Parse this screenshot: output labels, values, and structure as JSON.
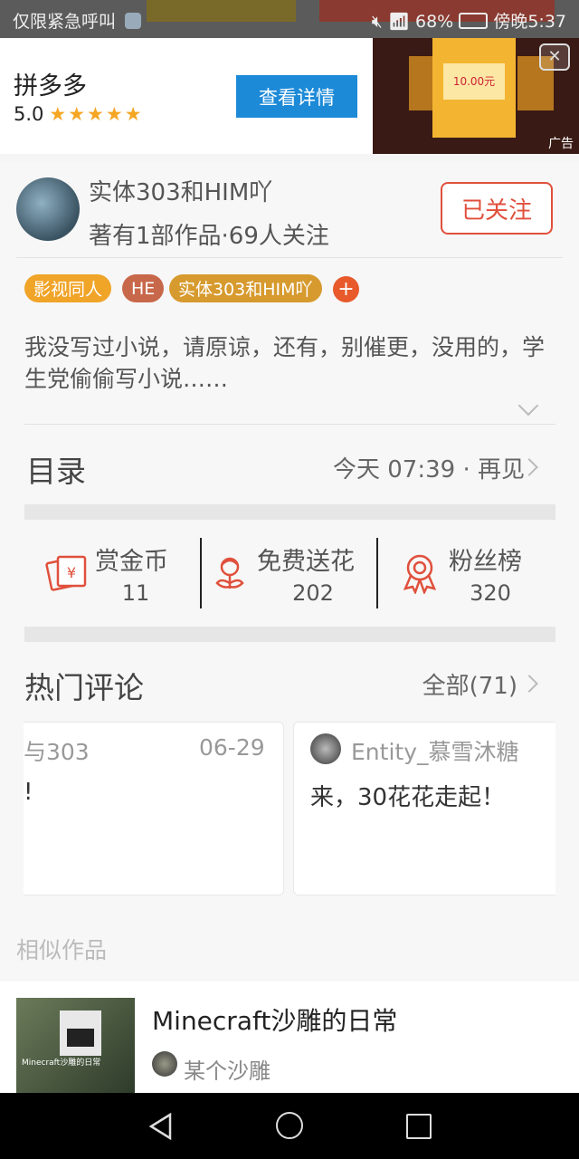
{
  "status_bar": {
    "left_text": "仅限紧急呼叫",
    "battery": "68%",
    "time": "傍晚5:37"
  },
  "ad": {
    "app_name": "拼多多",
    "rating": "5.0",
    "stars": "★★★★★",
    "button_label": "查看详情",
    "thumb_amount": "10.00元",
    "ad_tag": "广告"
  },
  "author": {
    "name": "实体303和HIM吖",
    "stats": "著有1部作品·69人关注",
    "follow_label": "已关注"
  },
  "tags": [
    "影视同人",
    "HE",
    "实体303和HIM吖",
    "+"
  ],
  "tag_colors": [
    "#f0a428",
    "#c8684a",
    "#d79a2e"
  ],
  "description": "我没写过小说，请原谅，还有，别催更，没用的，学生党偷偷写小说……",
  "catalog": {
    "title": "目录",
    "latest": "今天 07:39 · 再见"
  },
  "stats": [
    {
      "icon": "red-envelope-icon",
      "label": "赏金币",
      "value": "11"
    },
    {
      "icon": "flower-icon",
      "label": "免费送花",
      "value": "202"
    },
    {
      "icon": "ribbon-medal-icon",
      "label": "粉丝榜",
      "value": "320"
    }
  ],
  "comments": {
    "title": "热门评论",
    "all_label": "全部(71)",
    "cards": [
      {
        "user": "与303",
        "date": "06-29",
        "text": "!"
      },
      {
        "user": "Entity_慕雪沐糖",
        "text": "来，30花花走起！"
      }
    ]
  },
  "similar": {
    "label": "相似作品",
    "book_title": "Minecraft沙雕的日常",
    "book_author": "某个沙雕",
    "cover_text": "Minecraft沙雕的日常"
  },
  "colors": {
    "accent": "#e0503c",
    "ad_button": "#1d8ad8"
  }
}
